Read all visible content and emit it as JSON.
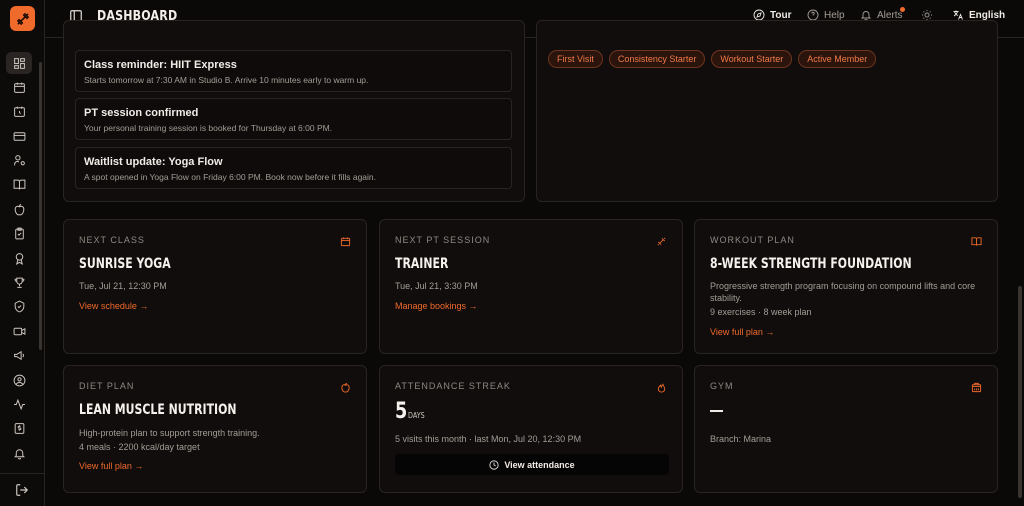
{
  "header": {
    "title": "DASHBOARD",
    "tour_label": "Tour",
    "help_label": "Help",
    "alerts_label": "Alerts",
    "language_label": "English"
  },
  "sidebar": {
    "icons": [
      "dashboard-icon",
      "calendar-icon",
      "calendar-clock-icon",
      "credit-card-icon",
      "user-cog-icon",
      "book-open-icon",
      "apple-icon",
      "clipboard-icon",
      "award-icon",
      "trophy-icon",
      "badge-icon",
      "video-icon",
      "megaphone-icon",
      "user-circle-icon",
      "activity-icon",
      "dollar-icon",
      "bell-icon"
    ]
  },
  "notifications": [
    {
      "title": "Class reminder: HIIT Express",
      "body": "Starts tomorrow at 7:30 AM in Studio B. Arrive 10 minutes early to warm up."
    },
    {
      "title": "PT session confirmed",
      "body": "Your personal training session is booked for Thursday at 6:00 PM."
    },
    {
      "title": "Waitlist update: Yoga Flow",
      "body": "A spot opened in Yoga Flow on Friday 6:00 PM. Book now before it fills again."
    }
  ],
  "achievements": [
    "First Visit",
    "Consistency Starter",
    "Workout Starter",
    "Active Member"
  ],
  "cards": {
    "next_class": {
      "label": "NEXT CLASS",
      "title": "SUNRISE YOGA",
      "time": "Tue, Jul 21, 12:30 PM",
      "link": "View schedule →"
    },
    "next_pt": {
      "label": "NEXT PT SESSION",
      "title": "TRAINER",
      "time": "Tue, Jul 21, 3:30 PM",
      "link": "Manage bookings →"
    },
    "workout_plan": {
      "label": "WORKOUT PLAN",
      "title": "8-WEEK STRENGTH FOUNDATION",
      "desc": "Progressive strength program focusing on compound lifts and core stability.",
      "meta": "9 exercises · 8 week plan",
      "link": "View full plan →"
    },
    "diet_plan": {
      "label": "DIET PLAN",
      "title": "LEAN MUSCLE NUTRITION",
      "desc": "High-protein plan to support strength training.",
      "meta": "4 meals · 2200 kcal/day target",
      "link": "View full plan →"
    },
    "streak": {
      "label": "ATTENDANCE STREAK",
      "value": "5",
      "unit": "DAYS",
      "meta": "5 visits this month · last Mon, Jul 20, 12:30 PM",
      "button": "View attendance"
    },
    "gym": {
      "label": "GYM",
      "branch": "Branch: Marina"
    }
  },
  "colors": {
    "accent": "#f06a2b",
    "background": "#0b0908",
    "card": "#100d0c"
  }
}
